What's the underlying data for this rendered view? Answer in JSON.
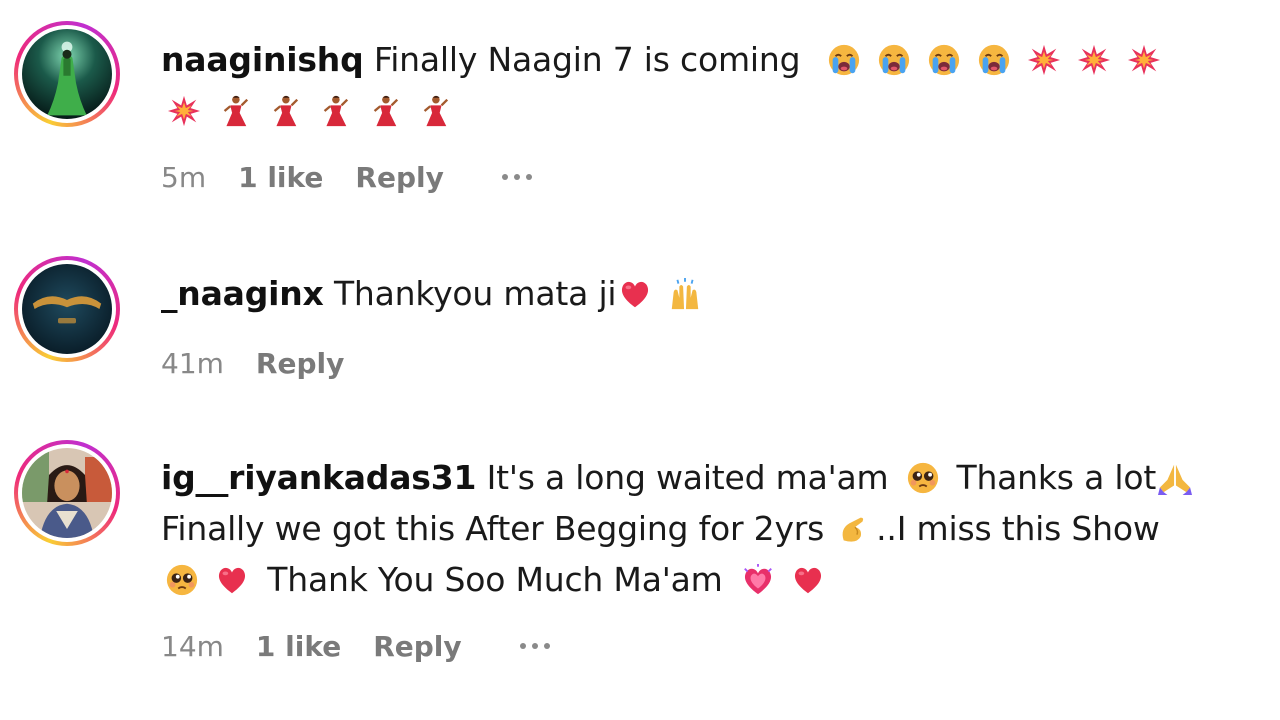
{
  "comments": [
    {
      "username": "naaginishq",
      "text": "Finally Naagin 7 is coming",
      "emojis_line1": [
        "loudly-crying-face",
        "loudly-crying-face",
        "loudly-crying-face",
        "loudly-crying-face",
        "collision",
        "collision",
        "collision"
      ],
      "emojis_line2": [
        "collision",
        "woman-dancing",
        "woman-dancing",
        "woman-dancing",
        "woman-dancing",
        "woman-dancing"
      ],
      "time": "5m",
      "likes": "1 like",
      "reply": "Reply"
    },
    {
      "username": "_naaginx",
      "text": "Thankyou mata ji",
      "emojis": [
        "red-heart",
        "raising-hands"
      ],
      "time": "41m",
      "reply": "Reply"
    },
    {
      "username": "ig__riyankadas31",
      "line1_text_a": "It's a long waited ma'am",
      "line1_text_b": "Thanks a lot",
      "line2_text_a": "Finally we got this After Begging for 2yrs",
      "line2_text_b": "..I miss this Show",
      "line3_text": "Thank You Soo Much Ma'am",
      "emojis": [
        "pleading-face",
        "folded-hands",
        "pinching-hand",
        "pleading-face",
        "red-heart",
        "growing-heart",
        "red-heart"
      ],
      "time": "14m",
      "likes": "1 like",
      "reply": "Reply"
    }
  ],
  "colors": {
    "username": "#111111",
    "meta": "#7a7a7a",
    "story_ring_start": "#f9ce34",
    "story_ring_end": "#ee2a7b"
  }
}
